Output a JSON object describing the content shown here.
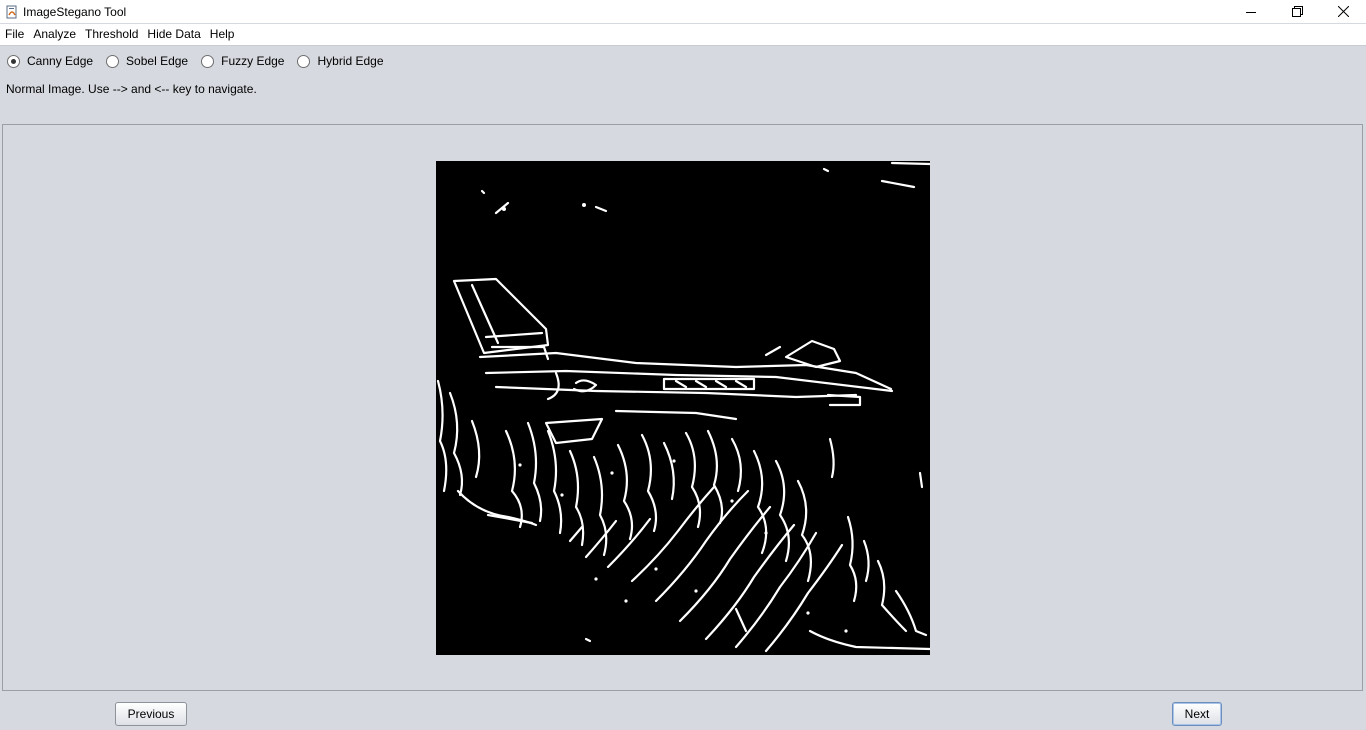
{
  "window": {
    "title": "ImageStegano Tool",
    "controls": [
      "minimize-icon",
      "restore-icon",
      "close-icon"
    ]
  },
  "menu": {
    "items": [
      "File",
      "Analyze",
      "Threshold",
      "Hide Data",
      "Help"
    ]
  },
  "edge_options": {
    "items": [
      "Canny Edge",
      "Sobel Edge",
      "Fuzzy Edge",
      "Hybrid Edge"
    ],
    "selected": "Canny Edge"
  },
  "status": {
    "text": "Normal Image. Use --> and <-- key to navigate."
  },
  "navigation": {
    "previous_label": "Previous",
    "next_label": "Next"
  },
  "colors": {
    "background": "#d6d9df",
    "image_background": "#000000",
    "edges": "#ffffff"
  }
}
